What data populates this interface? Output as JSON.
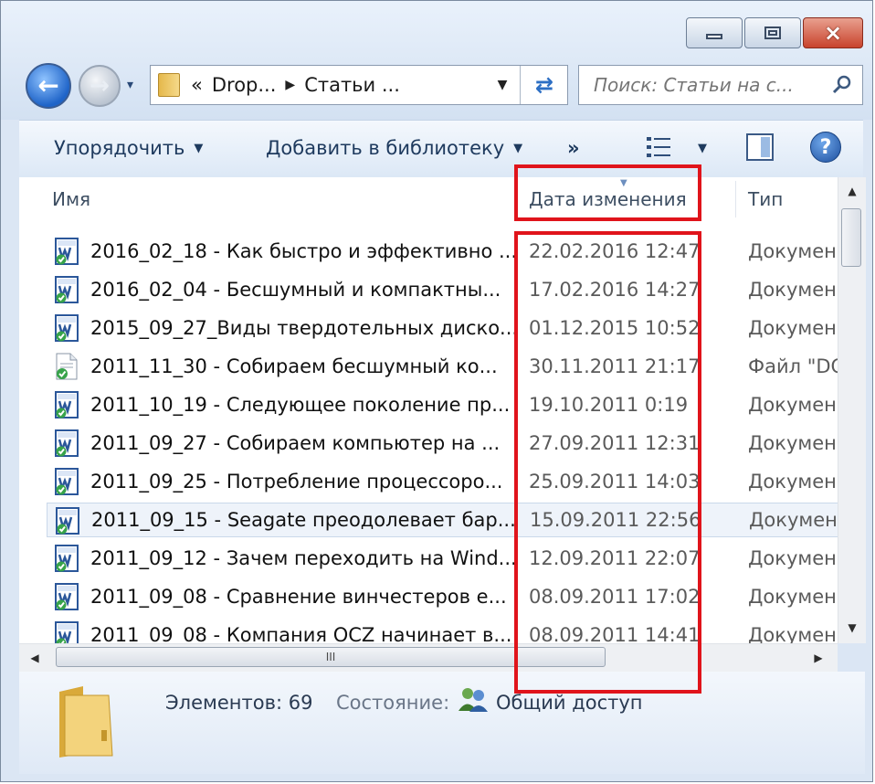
{
  "window": {
    "controls": {
      "minimize": "minimize",
      "maximize": "maximize",
      "close": "×"
    }
  },
  "nav": {
    "breadcrumb": [
      "«",
      "Drop...",
      "Статьи ..."
    ]
  },
  "search": {
    "placeholder": "Поиск: Статьи на с..."
  },
  "toolbar": {
    "organize": "Упорядочить",
    "add_to_library": "Добавить в библиотеку",
    "more": "»"
  },
  "columns": {
    "name": "Имя",
    "date": "Дата изменения",
    "type": "Тип"
  },
  "files": [
    {
      "name": "2016_02_18 - Как быстро и эффективно ...",
      "date": "22.02.2016 12:47",
      "type": "Докумен",
      "icon": "word-doc-icon"
    },
    {
      "name": "2016_02_04 - Бесшумный и компактны...",
      "date": "17.02.2016 14:27",
      "type": "Докумен",
      "icon": "word-doc-icon"
    },
    {
      "name": "2015_09_27_Виды твердотельных диско...",
      "date": "01.12.2015 10:52",
      "type": "Докумен",
      "icon": "word-doc-icon"
    },
    {
      "name": "2011_11_30 - Собираем бесшумный ко...",
      "date": "30.11.2011 21:17",
      "type": "Файл \"DC",
      "icon": "text-file-icon"
    },
    {
      "name": "2011_10_19 - Следующее поколение пр...",
      "date": "19.10.2011 0:19",
      "type": "Докумен",
      "icon": "word-doc-icon"
    },
    {
      "name": "2011_09_27 - Собираем компьютер на ...",
      "date": "27.09.2011 12:31",
      "type": "Докумен",
      "icon": "word-doc-icon"
    },
    {
      "name": "2011_09_25 - Потребление процессоро...",
      "date": "25.09.2011 14:03",
      "type": "Докумен",
      "icon": "word-doc-icon"
    },
    {
      "name": "2011_09_15 - Seagate преодолевает бар...",
      "date": "15.09.2011 22:56",
      "type": "Докумен",
      "icon": "word-doc-icon"
    },
    {
      "name": "2011_09_12 - Зачем переходить на Wind...",
      "date": "12.09.2011 22:07",
      "type": "Докумен",
      "icon": "word-doc-icon"
    },
    {
      "name": "2011_09_08 - Сравнение винчестеров е...",
      "date": "08.09.2011 17:02",
      "type": "Докумен",
      "icon": "word-doc-icon"
    },
    {
      "name": "2011_09_08 - Компания OCZ начинает в...",
      "date": "08.09.2011 14:41",
      "type": "Докумен",
      "icon": "word-doc-icon"
    }
  ],
  "selected_index": 7,
  "scroll": {
    "hthumb_grip": "III"
  },
  "status": {
    "count": "Элементов: 69",
    "state_label": "Состояние:",
    "share": "Общий доступ"
  },
  "colors": {
    "highlight": "#e0141b",
    "selection": "#eef3fa",
    "accent": "#1f64c8"
  }
}
